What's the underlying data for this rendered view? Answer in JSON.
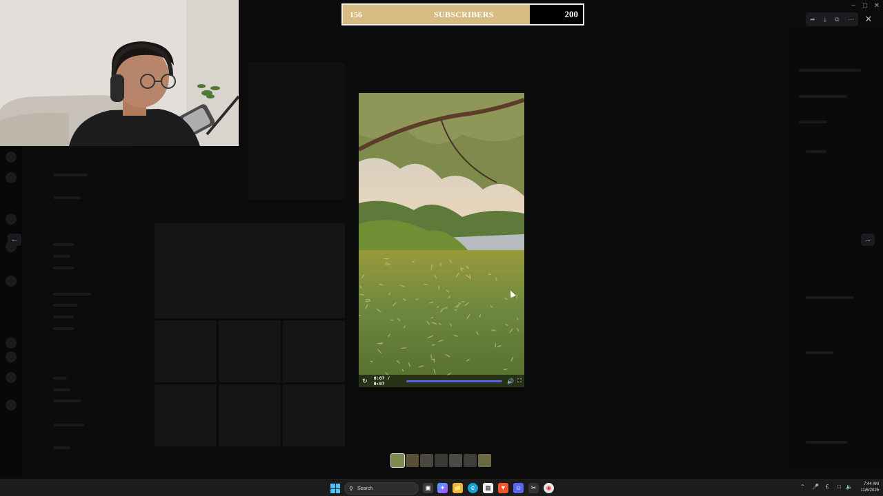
{
  "subscriber_goal": {
    "current": "156",
    "label": "SUBSCRIBERS",
    "goal": "200",
    "progress_fraction": 0.78,
    "fill_color": "#d8bd83"
  },
  "window_controls": {
    "minimize_icon": "minimize-icon",
    "maximize_icon": "maximize-icon",
    "close_icon": "close-icon"
  },
  "viewer_toolbar": {
    "icons": [
      "forward-icon",
      "download-icon",
      "open-external-icon",
      "more-icon"
    ],
    "close_icon": "close-icon"
  },
  "navigation": {
    "prev_icon": "arrow-left-icon",
    "next_icon": "arrow-right-icon"
  },
  "video": {
    "time": "0:07 / 0:07",
    "progress_fraction": 1.0,
    "progress_color": "#5865f2",
    "replay_icon": "replay-icon",
    "volume_icon": "volume-icon",
    "fullscreen_icon": "fullscreen-icon"
  },
  "thumbnails": {
    "count": 7,
    "active_index": 0,
    "colors": [
      "#7f8b4c",
      "#5a4e3a",
      "#4a4640",
      "#3b3a36",
      "#4c4a45",
      "#3e3d39",
      "#6b6a42"
    ]
  },
  "taskbar": {
    "search_label": "Search",
    "apps": [
      "task-view-icon",
      "copilot-icon",
      "file-explorer-icon",
      "edge-icon",
      "store-icon",
      "brave-icon",
      "discord-icon",
      "snipping-icon",
      "chrome-icon"
    ],
    "tray_icons": [
      "chevron-up-icon",
      "microphone-icon",
      "pound-icon",
      "network-icon",
      "volume-icon"
    ],
    "time": "7:44 AM",
    "date": "11/6/2025"
  }
}
